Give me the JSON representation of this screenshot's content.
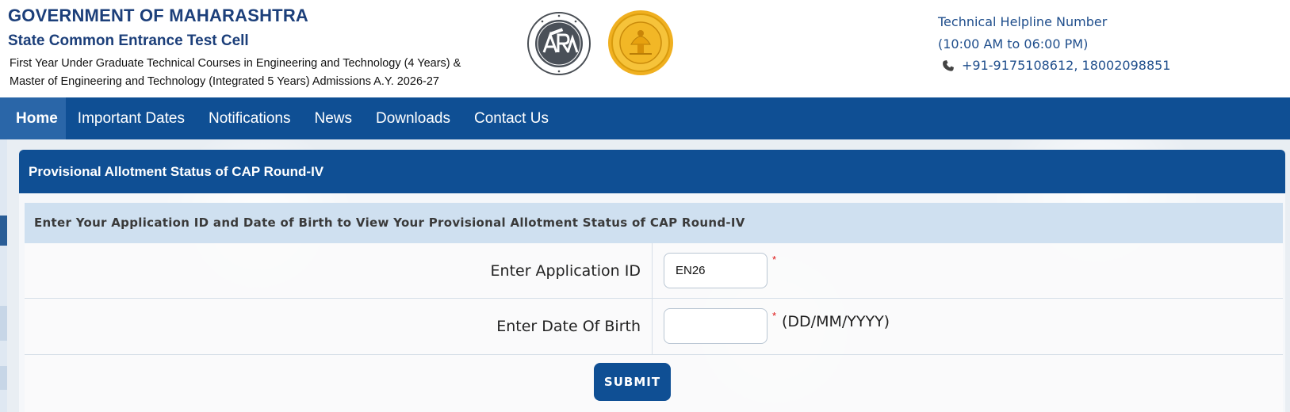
{
  "header": {
    "gov_title": "GOVERNMENT OF MAHARASHTRA",
    "cell_title": "State Common Entrance Test Cell",
    "course_line1": "First Year Under Graduate Technical Courses in Engineering and Technology (4 Years) &",
    "course_line2": "Master of Engineering and Technology (Integrated 5 Years) Admissions A.Y. 2026-27",
    "logos": [
      "ara-logo",
      "maharashtra-seal"
    ]
  },
  "helpline": {
    "title": "Technical Helpline Number",
    "hours": "(10:00 AM to 06:00 PM)",
    "icon": "phone-icon",
    "numbers": "+91-9175108612, 18002098851"
  },
  "nav": {
    "items": [
      {
        "label": "Home",
        "active": true
      },
      {
        "label": "Important Dates"
      },
      {
        "label": "Notifications"
      },
      {
        "label": "News"
      },
      {
        "label": "Downloads"
      },
      {
        "label": "Contact Us"
      }
    ]
  },
  "panel": {
    "title": "Provisional Allotment Status of CAP Round-IV",
    "instruction": "Enter Your Application ID and Date of Birth to View Your Provisional Allotment Status of CAP Round-IV"
  },
  "form": {
    "application_label": "Enter Application ID",
    "application_value": "EN26",
    "dob_label": "Enter Date Of Birth",
    "dob_value": "",
    "required_mark": "*",
    "dob_format": "(DD/MM/YYYY)",
    "submit_label": "SUBMIT"
  },
  "colors": {
    "primary": "#0f4f94",
    "header_text": "#1c3f7a",
    "helpline_text": "#1f4e8c",
    "instruction_bg": "#cfe0f0",
    "required": "#dd1111"
  }
}
